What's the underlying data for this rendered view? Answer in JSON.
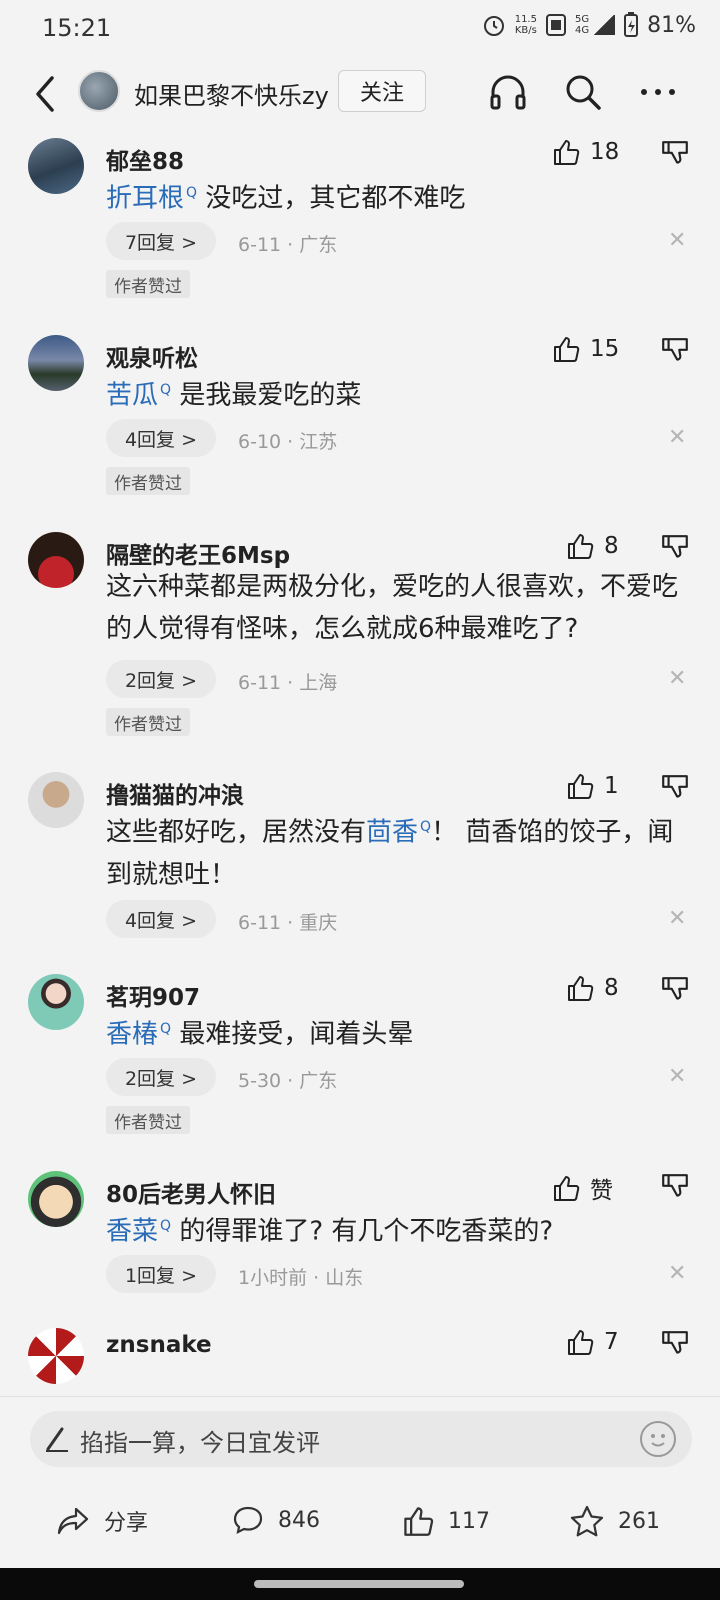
{
  "status": {
    "time": "15:21",
    "net_speed_top": "11.5",
    "net_speed_bottom": "KB/s",
    "net_type": "5G",
    "net_type_sub": "4G",
    "battery": "81%"
  },
  "header": {
    "author_name": "如果巴黎不快乐zy",
    "follow_label": "关注"
  },
  "comments": [
    {
      "name": "郁垒88",
      "likes": "18",
      "keyword": "折耳根",
      "text": "没吃过，其它都不难吃",
      "replies": "7回复 >",
      "meta": "6-11 · 广东",
      "tag": "作者赞过"
    },
    {
      "name": "观泉听松",
      "likes": "15",
      "keyword": "苦瓜",
      "text": "是我最爱吃的菜",
      "replies": "4回复 >",
      "meta": "6-10 · 江苏",
      "tag": "作者赞过"
    },
    {
      "name": "隔壁的老王6Msp",
      "likes": "8",
      "text": "这六种菜都是两极分化，爱吃的人很喜欢，不爱吃的人觉得有怪味，怎么就成6种最难吃了?",
      "replies": "2回复 >",
      "meta": "6-11 · 上海",
      "tag": "作者赞过"
    },
    {
      "name": "撸猫猫的冲浪",
      "likes": "1",
      "text_before": "这些都好吃，居然没有",
      "keyword": "茴香",
      "text_after": "！ 茴香馅的饺子，闻到就想吐！",
      "replies": "4回复 >",
      "meta": "6-11 · 重庆"
    },
    {
      "name": "茗玥907",
      "likes": "8",
      "keyword": "香椿",
      "text": "最难接受，闻着头晕",
      "replies": "2回复 >",
      "meta": "5-30 · 广东",
      "tag": "作者赞过"
    },
    {
      "name": "80后老男人怀旧",
      "likes": "赞",
      "keyword": "香菜",
      "text": "的得罪谁了? 有几个不吃香菜的?",
      "replies": "1回复 >",
      "meta": "1小时前 · 山东"
    },
    {
      "name": "znsnake",
      "likes": "7"
    }
  ],
  "close_symbol": "✕",
  "keyword_marker": "Q",
  "bottom": {
    "input_placeholder": "掐指一算，今日宜发评",
    "share_label": "分享",
    "comment_count": "846",
    "like_count": "117",
    "fav_count": "261"
  }
}
